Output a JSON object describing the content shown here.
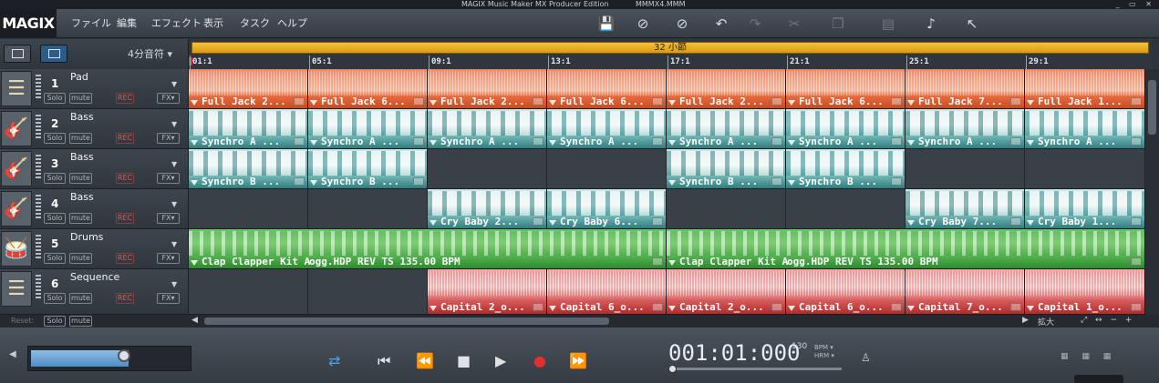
{
  "window": {
    "app_title": "MAGIX Music Maker MX Producer Edition",
    "document_title": "MMMX4.MMM",
    "controls": "_ ▭ ✕"
  },
  "menu": {
    "logo": "MAGIX",
    "items": [
      "ファイル",
      "編集",
      "エフェクト",
      "表示",
      "タスク",
      "ヘルプ"
    ]
  },
  "toolbar": {
    "icons": [
      "save-icon",
      "mix-down-icon",
      "link-icon",
      "undo-icon",
      "redo-icon",
      "cut-icon",
      "copy-icon",
      "paste-icon",
      "note-icon",
      "pointer-icon"
    ]
  },
  "arrange": {
    "quantize": "4分音符 ▾",
    "loop_label": "32 小節",
    "ruler": [
      "01:1",
      "05:1",
      "09:1",
      "13:1",
      "17:1",
      "21:1",
      "25:1",
      "29:1"
    ]
  },
  "tracks": [
    {
      "num": "1",
      "name": "Pad",
      "icon": "synth-icon",
      "solo": "Solo",
      "mute": "mute",
      "rec": "REC",
      "fx": "FX▾"
    },
    {
      "num": "2",
      "name": "Bass",
      "icon": "guitar-icon",
      "solo": "Solo",
      "mute": "mute",
      "rec": "REC",
      "fx": "FX▾"
    },
    {
      "num": "3",
      "name": "Bass",
      "icon": "guitar-icon",
      "solo": "Solo",
      "mute": "mute",
      "rec": "REC",
      "fx": "FX▾"
    },
    {
      "num": "4",
      "name": "Bass",
      "icon": "guitar-icon",
      "solo": "Solo",
      "mute": "mute",
      "rec": "REC",
      "fx": "FX▾"
    },
    {
      "num": "5",
      "name": "Drums",
      "icon": "drum-icon",
      "solo": "Solo",
      "mute": "mute",
      "rec": "REC",
      "fx": "FX▾"
    },
    {
      "num": "6",
      "name": "Sequence",
      "icon": "synth-icon",
      "solo": "Solo",
      "mute": "mute",
      "rec": "REC",
      "fx": "FX▾"
    }
  ],
  "clips": {
    "pad": [
      "Full Jack 2...",
      "Full Jack 6...",
      "Full Jack 2...",
      "Full Jack 6...",
      "Full Jack 2...",
      "Full Jack 6...",
      "Full Jack 7...",
      "Full Jack 1..."
    ],
    "bass1": [
      "Synchro A ...",
      "Synchro A ...",
      "Synchro A ...",
      "Synchro A ...",
      "Synchro A ...",
      "Synchro A ...",
      "Synchro A ...",
      "Synchro A ..."
    ],
    "bass2": [
      "Synchro B ...",
      "Synchro B ...",
      "",
      "",
      "Synchro B ...",
      "Synchro B ...",
      "",
      ""
    ],
    "bass3": [
      "",
      "",
      "Cry Baby 2...",
      "Cry Baby 6...",
      "",
      "",
      "Cry Baby 7...",
      "Cry Baby 1..."
    ],
    "drums_a": "Clap Clapper Kit A",
    "drums_a_rest": "ogg.HDP  REV  TS  135.00 BPM",
    "drums_b": "Clap Clapper Kit A",
    "drums_b_rest": "ogg.HDP  REV  TS  135.00 BPM",
    "seq": [
      "",
      "",
      "Capital 2_o...",
      "Capital 6_o...",
      "Capital 2_o...",
      "Capital 6_o...",
      "Capital 7_o...",
      "Capital 1_o..."
    ]
  },
  "bottom": {
    "reset": "Reset:",
    "solo": "Solo",
    "mute": "mute",
    "zoom": "拡大"
  },
  "transport": {
    "time": "001:01:000",
    "bpm": "130",
    "bpm_label": "BPM ▾",
    "hrm_label": "HRM ▾",
    "master_volume": 0.62
  }
}
